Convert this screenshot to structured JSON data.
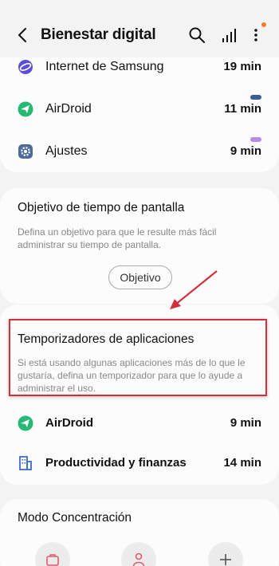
{
  "header": {
    "title": "Bienestar digital",
    "back_icon": "back-arrow-icon",
    "search_icon": "search-icon",
    "stats_icon": "bar-chart-icon",
    "more_icon": "more-vertical-icon",
    "notification_dot_color": "#f07c2c"
  },
  "apps_usage": [
    {
      "name": "Internet de Samsung",
      "time": "19 min",
      "icon": "samsung-internet-icon",
      "icon_color": "#5a4fd6"
    },
    {
      "name": "AirDroid",
      "time": "11 min",
      "icon": "airdroid-icon",
      "icon_color": "#27b874",
      "bar_color": "#3d5a99"
    },
    {
      "name": "Ajustes",
      "time": "9 min",
      "icon": "settings-gear-icon",
      "icon_color": "#4d6a9a",
      "bar_color": "#b78ce8"
    }
  ],
  "screen_goal": {
    "title": "Objetivo de tiempo de pantalla",
    "description": "Defina un objetivo para que le resulte más fácil administrar su tiempo de pantalla.",
    "button_label": "Objetivo"
  },
  "app_timers": {
    "title": "Temporizadores de aplicaciones",
    "description": "Si está usando algunas aplicaciones más de lo que le gustaría, defina un temporizador para que lo ayude a administrar el uso.",
    "items": [
      {
        "name": "AirDroid",
        "time": "9 min",
        "icon": "airdroid-icon"
      },
      {
        "name": "Productividad y finanzas",
        "time": "14 min",
        "icon": "building-icon"
      }
    ]
  },
  "focus_mode": {
    "title": "Modo Concentración",
    "options": [
      {
        "icon": "briefcase-icon"
      },
      {
        "icon": "person-icon"
      },
      {
        "icon": "plus-icon"
      }
    ]
  },
  "annotation": {
    "highlight_color": "#d32f3c"
  }
}
